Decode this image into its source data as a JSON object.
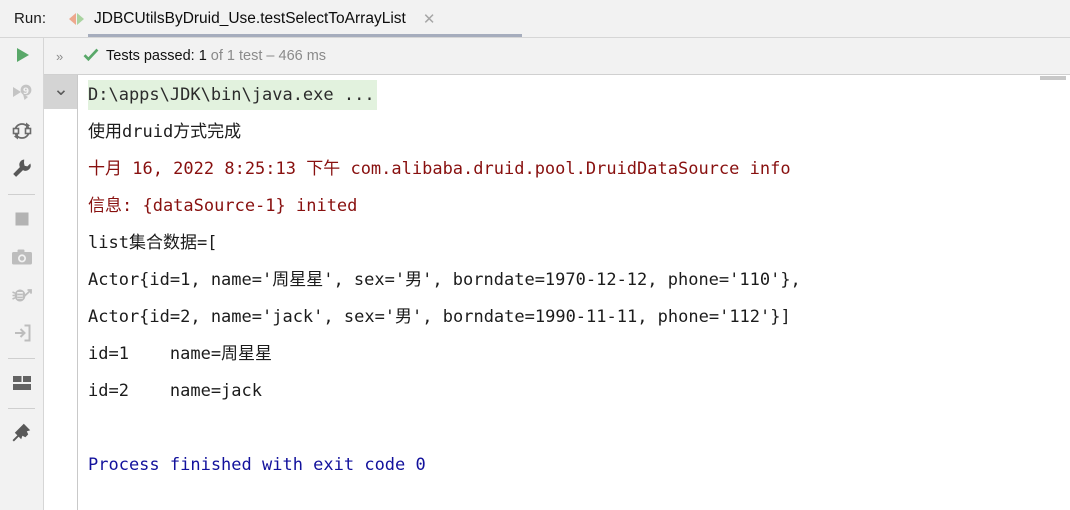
{
  "window": {
    "run_label": "Run:",
    "accent_green": "#59a869",
    "log_red": "#88100f",
    "exit_blue": "#12119c",
    "cmd_highlight_bg": "#e2f2de"
  },
  "tab": {
    "title": "JDBCUtilsByDruid_Use.testSelectToArrayList",
    "icon": "junit-test-icon",
    "close_glyph": "✕",
    "active": true
  },
  "status": {
    "expand_glyph": "»",
    "check_icon": "green-check-icon",
    "prefix": "Tests passed: ",
    "count": "1",
    "detail": " of 1 test – 466 ms"
  },
  "sidebar": {
    "items": [
      {
        "name": "rerun-button",
        "icon": "green-play-icon"
      },
      {
        "name": "rerun-failed-tests-button",
        "icon": "rerun-nine-icon"
      },
      {
        "name": "toggle-auto-test-button",
        "icon": "rerun-loop-icon"
      },
      {
        "name": "test-settings-button",
        "icon": "wrench-icon"
      },
      {
        "name": "stop-button",
        "icon": "stop-square-icon"
      },
      {
        "name": "export-snapshot-button",
        "icon": "camera-icon"
      },
      {
        "name": "debug-button",
        "icon": "debug-bug-icon"
      },
      {
        "name": "import-tests-button",
        "icon": "import-arrow-icon"
      },
      {
        "name": "layout-button",
        "icon": "split-layout-icon"
      },
      {
        "name": "pin-tab-button",
        "icon": "pin-icon"
      }
    ]
  },
  "gutter": {
    "fold_glyph": "⌄"
  },
  "console": {
    "lines": [
      {
        "text": "D:\\apps\\JDK\\bin\\java.exe ...",
        "style": "cmd"
      },
      {
        "text": "使用druid方式完成",
        "style": "stdout"
      },
      {
        "text": "十月 16, 2022 8:25:13 下午 com.alibaba.druid.pool.DruidDataSource info",
        "style": "logred"
      },
      {
        "text": "信息: {dataSource-1} inited",
        "style": "logred"
      },
      {
        "text": "list集合数据=[",
        "style": "stdout"
      },
      {
        "text": "Actor{id=1, name='周星星', sex='男', borndate=1970-12-12, phone='110'},",
        "style": "stdout"
      },
      {
        "text": "Actor{id=2, name='jack', sex='男', borndate=1990-11-11, phone='112'}]",
        "style": "stdout"
      },
      {
        "text": "id=1    name=周星星",
        "style": "stdout"
      },
      {
        "text": "id=2    name=jack",
        "style": "stdout"
      },
      {
        "text": " ",
        "style": "blank"
      },
      {
        "text": "Process finished with exit code 0",
        "style": "exitblue"
      }
    ]
  }
}
